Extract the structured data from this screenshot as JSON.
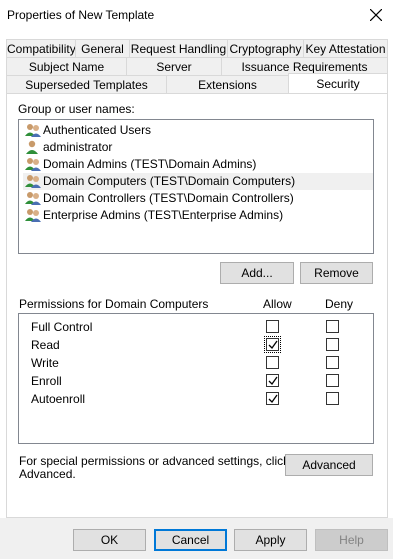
{
  "window": {
    "title": "Properties of New Template"
  },
  "tabs": {
    "row1": [
      "Compatibility",
      "General",
      "Request Handling",
      "Cryptography",
      "Key Attestation"
    ],
    "row2": [
      "Subject Name",
      "Server",
      "Issuance Requirements"
    ],
    "row3": [
      "Superseded Templates",
      "Extensions",
      "Security"
    ],
    "active": "Security"
  },
  "security": {
    "group_label": "Group or user names:",
    "users": [
      {
        "name": "Authenticated Users",
        "icon": "group-icon"
      },
      {
        "name": "administrator",
        "icon": "user-icon"
      },
      {
        "name": "Domain Admins (TEST\\Domain Admins)",
        "icon": "group-icon"
      },
      {
        "name": "Domain Computers (TEST\\Domain Computers)",
        "icon": "group-icon",
        "selected": true
      },
      {
        "name": "Domain Controllers (TEST\\Domain Controllers)",
        "icon": "group-icon"
      },
      {
        "name": "Enterprise Admins (TEST\\Enterprise Admins)",
        "icon": "group-icon"
      }
    ],
    "add_label": "Add...",
    "remove_label": "Remove",
    "perm_label": "Permissions for Domain Computers",
    "allow_label": "Allow",
    "deny_label": "Deny",
    "permissions": [
      {
        "name": "Full Control",
        "allow": false,
        "deny": false
      },
      {
        "name": "Read",
        "allow": true,
        "deny": false
      },
      {
        "name": "Write",
        "allow": false,
        "deny": false
      },
      {
        "name": "Enroll",
        "allow": true,
        "deny": false
      },
      {
        "name": "Autoenroll",
        "allow": true,
        "deny": false
      }
    ],
    "special_line1": "For special permissions or advanced settings, click",
    "special_line2": "Advanced.",
    "advanced_label": "Advanced"
  },
  "buttons": {
    "ok": "OK",
    "cancel": "Cancel",
    "apply": "Apply",
    "help": "Help"
  },
  "colors": {
    "selection": "#f0f0f0",
    "default_border": "#0078d7",
    "button_bg": "#e1e1e1"
  }
}
